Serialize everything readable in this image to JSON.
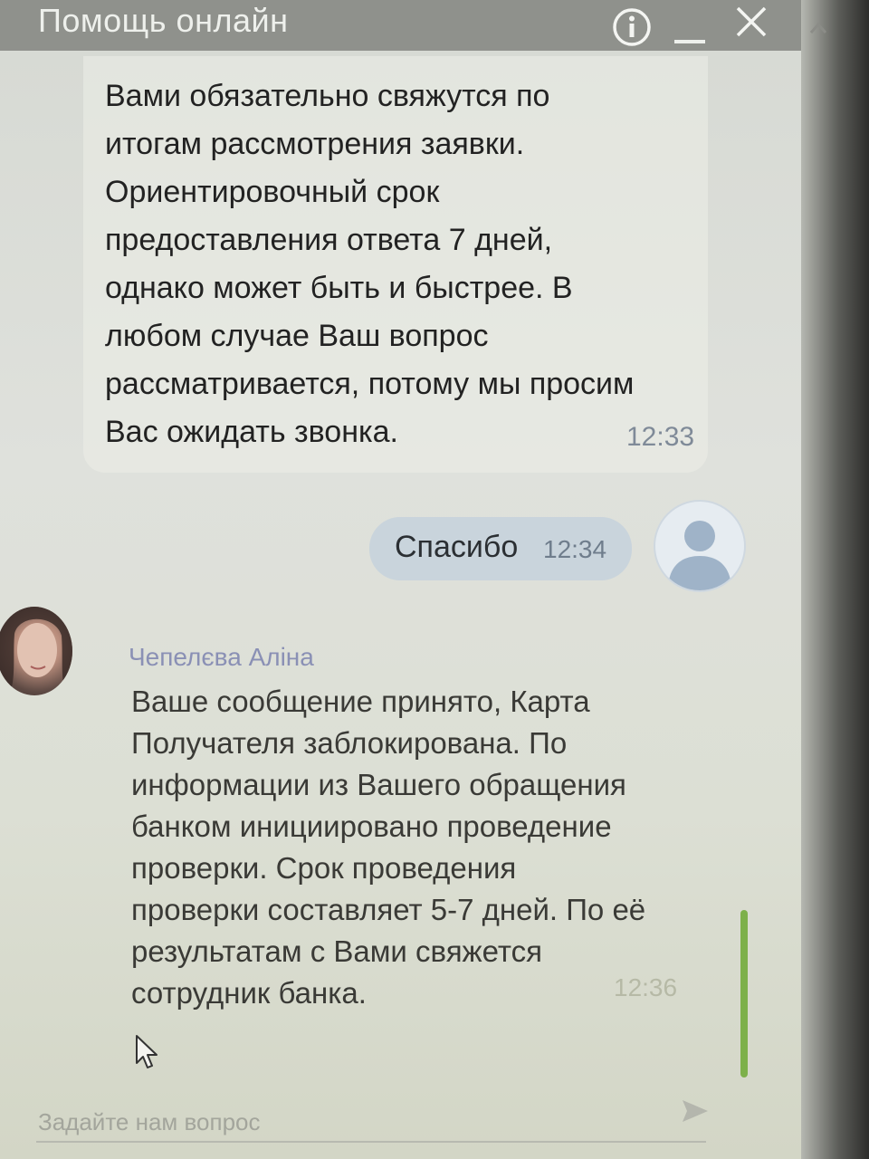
{
  "window": {
    "title": "Помощь онлайн"
  },
  "messages": [
    {
      "lines": [
        "Вами обязательно свяжутся по",
        "итогам рассмотрения заявки.",
        "Ориентировочный срок",
        "предоставления ответа 7 дней,",
        "однако может быть и быстрее. В",
        "любом случае Ваш вопрос",
        "рассматривается, потому мы просим",
        "Вас ожидать звонка."
      ],
      "time": "12:33"
    },
    {
      "text": "Спасибо",
      "time": "12:34"
    },
    {
      "sender": "Чепелєва Аліна",
      "lines": [
        "Ваше сообщение принято, Карта",
        "Получателя заблокирована. По",
        "информации из Вашего обращения",
        "банком инициировано проведение",
        "проверки. Срок проведения",
        "проверки составляет 5-7 дней. По её",
        "результатам с Вами свяжется",
        "сотрудник банка."
      ],
      "time": "12:36"
    }
  ],
  "composer": {
    "placeholder": "Задайте нам вопрос"
  },
  "icons": {
    "info": "info-icon",
    "minimize": "minimize-icon",
    "close": "close-icon",
    "send": "send-icon",
    "user_avatar": "user-avatar-icon",
    "cursor": "mouse-cursor-icon"
  },
  "colors": {
    "titlebar": "#8f918c",
    "outgoing_bubble": "#c9d4dc",
    "agent_name": "#8a90b5",
    "timestamp": "#7f8a98",
    "scrollbar": "#7db04a"
  }
}
